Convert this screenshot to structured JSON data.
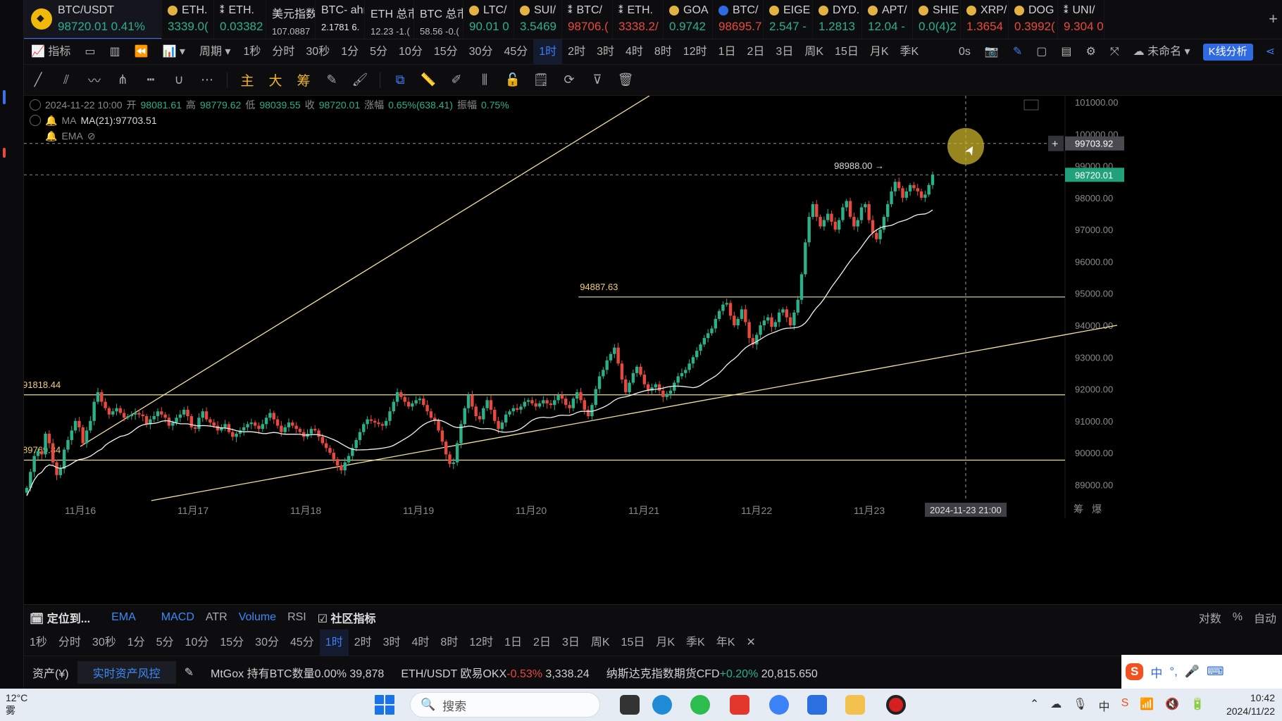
{
  "tickers": [
    {
      "name": "BTC/USDT",
      "price": "98720.01",
      "change": "0.41%",
      "dir": "up",
      "main": true
    },
    {
      "name": "ETH.",
      "price": "3339.0(",
      "dir": "up",
      "icon": "dot"
    },
    {
      "name": "ETH.",
      "price": "0.03382",
      "dir": "up",
      "icon": "x"
    },
    {
      "name": "美元指数",
      "price": "107.0887",
      "dir": "nt",
      "icon": "none"
    },
    {
      "name": "BTC- ahr",
      "price": "2.1781  6.",
      "dir": "nt2",
      "icon": "none"
    },
    {
      "name": "ETH 总市",
      "price": "12.23  -1.(",
      "dir": "nt",
      "icon": "none"
    },
    {
      "name": "BTC 总市",
      "price": "58.56  -0.(",
      "dir": "nt",
      "icon": "none"
    },
    {
      "name": "LTC/",
      "price": "90.01  0",
      "dir": "up",
      "icon": "dot"
    },
    {
      "name": "SUI/",
      "price": "3.5469",
      "dir": "up",
      "icon": "dot"
    },
    {
      "name": "BTC/",
      "price": "98706.(",
      "dir": "dn",
      "icon": "x"
    },
    {
      "name": "ETH.",
      "price": "3338.2/",
      "dir": "dn",
      "icon": "x"
    },
    {
      "name": "GOA",
      "price": "0.9742",
      "dir": "up",
      "icon": "dot"
    },
    {
      "name": "BTC/",
      "price": "98695.7",
      "dir": "dn",
      "icon": "blue"
    },
    {
      "name": "EIGE",
      "price": "2.547  -",
      "dir": "up",
      "icon": "dot"
    },
    {
      "name": "DYD.",
      "price": "1.2813",
      "dir": "up",
      "icon": "dot"
    },
    {
      "name": "APT/",
      "price": "12.04  -",
      "dir": "up",
      "icon": "dot"
    },
    {
      "name": "SHIE",
      "price": "0.0(4)2",
      "dir": "up",
      "icon": "dot"
    },
    {
      "name": "XRP/",
      "price": "1.3654",
      "dir": "dn",
      "icon": "dot"
    },
    {
      "name": "DOG",
      "price": "0.3992(",
      "dir": "dn",
      "icon": "dot"
    },
    {
      "name": "UNI/",
      "price": "9.304  0",
      "dir": "dn",
      "icon": "x"
    }
  ],
  "toolbar1": {
    "indicators": "指标",
    "period": "周期",
    "intervals": [
      "1秒",
      "分时",
      "30秒",
      "1分",
      "5分",
      "10分",
      "15分",
      "30分",
      "45分",
      "1时",
      "2时",
      "3时",
      "4时",
      "8时",
      "12时",
      "1日",
      "2日",
      "3日",
      "周K",
      "15日",
      "月K",
      "季K"
    ],
    "selected_interval": "1时",
    "countdown": "0s",
    "layout_name": "未命名",
    "kline_analysis": "K线分析"
  },
  "toolbar2": {
    "text_tools": [
      "主",
      "大",
      "筹"
    ]
  },
  "legend": {
    "date": "2024-11-22 10:00",
    "open_label": "开",
    "open": "98081.61",
    "high_label": "高",
    "high": "98779.62",
    "low_label": "低",
    "low": "98039.55",
    "close_label": "收",
    "close": "98720.01",
    "change_label": "涨幅",
    "change": "0.65%(638.41)",
    "amp_label": "振幅",
    "amp": "0.75%",
    "ma_name": "MA",
    "ma_value": "MA(21):97703.51",
    "ema_name": "EMA"
  },
  "chart_data": {
    "type": "candlestick",
    "symbol": "BTC/USDT",
    "interval": "1时",
    "ylim": [
      88500,
      101200
    ],
    "y_ticks": [
      101000,
      100000,
      99000,
      98000,
      97000,
      96000,
      95000,
      94000,
      93000,
      92000,
      91000,
      90000,
      89000
    ],
    "y_tick_labels": [
      "101000.00",
      "100000.00",
      "99000.00",
      "98000.00",
      "97000.00",
      "96000.00",
      "95000.00",
      "94000.00",
      "93000.00",
      "92000.00",
      "91000.00",
      "90000.00",
      "89000.00"
    ],
    "x_tick_labels": [
      "11月16",
      "11月17",
      "11月18",
      "11月19",
      "11月20",
      "11月21",
      "11月22",
      "11月23"
    ],
    "crosshair_time": "2024-11-23 21:00",
    "crosshair_price": "99703.92",
    "current_price": "98720.01",
    "high_marker": "98988.00 →",
    "horizontal_levels": [
      {
        "value": 94887.63,
        "label": "94887.63",
        "from_day": 4.42
      },
      {
        "value": 91818.44,
        "label": "91818.44",
        "from_day": 0
      },
      {
        "value": 89769.84,
        "label": "89769.84",
        "from_day": 0
      }
    ],
    "trendlines": [
      {
        "from": [
          0.0,
          90200
        ],
        "to": [
          5.05,
          101200
        ]
      },
      {
        "from": [
          0.63,
          88500
        ],
        "to": [
          9.2,
          94000
        ]
      }
    ],
    "closes": [
      88900,
      89400,
      89900,
      90050,
      89950,
      90600,
      90300,
      89700,
      89300,
      89500,
      90100,
      90400,
      90700,
      91000,
      90800,
      90300,
      90700,
      91000,
      91600,
      91900,
      91600,
      91400,
      91200,
      91300,
      91400,
      91250,
      91100,
      91150,
      91200,
      91250,
      91200,
      91150,
      90900,
      91050,
      91150,
      91300,
      91200,
      91100,
      90850,
      90950,
      91100,
      91200,
      91350,
      91150,
      90800,
      90750,
      91100,
      91300,
      91050,
      90950,
      90850,
      90700,
      90800,
      90900,
      90650,
      90500,
      90600,
      90700,
      90800,
      90900,
      90950,
      90850,
      90750,
      90900,
      91100,
      91250,
      91050,
      90850,
      90650,
      90800,
      90950,
      90850,
      90750,
      90650,
      90500,
      90600,
      90750,
      90700,
      90500,
      90300,
      90150,
      90000,
      89800,
      89600,
      89450,
      89700,
      89900,
      90150,
      90400,
      90650,
      90900,
      91050,
      91000,
      90950,
      90900,
      90850,
      91000,
      91300,
      91600,
      91900,
      91750,
      91600,
      91450,
      91550,
      91650,
      91700,
      91500,
      91300,
      91100,
      91000,
      90700,
      90350,
      89950,
      89650,
      89700,
      90300,
      90900,
      91400,
      91800,
      91450,
      91150,
      91050,
      91400,
      91650,
      91350,
      91000,
      90750,
      90950,
      91200,
      91300,
      91400,
      91350,
      91450,
      91600,
      91650,
      91550,
      91450,
      91550,
      91650,
      91550,
      91500,
      91650,
      91800,
      91700,
      91500,
      91400,
      91700,
      91900,
      91650,
      91350,
      91150,
      91500,
      92000,
      92400,
      92600,
      92900,
      93100,
      93300,
      92800,
      92300,
      91900,
      92200,
      92500,
      92700,
      92450,
      92150,
      91950,
      92050,
      92150,
      91950,
      91750,
      91850,
      91950,
      92200,
      92400,
      92500,
      92600,
      92800,
      93000,
      93200,
      93400,
      93600,
      93750,
      93900,
      94200,
      94450,
      94650,
      94700,
      94300,
      94000,
      94200,
      94500,
      94100,
      93600,
      93400,
      93700,
      94000,
      94150,
      94250,
      93950,
      94100,
      94400,
      94500,
      94250,
      94000,
      94400,
      94800,
      95600,
      96600,
      97400,
      97800,
      97400,
      97100,
      97300,
      97500,
      97250,
      97000,
      97300,
      97700,
      97900,
      97400,
      97100,
      97300,
      97700,
      97800,
      97300,
      96900,
      96700,
      97000,
      97400,
      97800,
      98200,
      98500,
      98300,
      98000,
      98200,
      98400,
      98300,
      98200,
      98000,
      98100,
      98400,
      98720
    ],
    "ma_label": "MA(21):97703.51"
  },
  "indicator_bar": {
    "locate": "定位到...",
    "main": [
      "EMA"
    ],
    "sub": [
      "MACD",
      "ATR",
      "Volume",
      "RSI"
    ],
    "community": "社区指标",
    "right": [
      "对数",
      "%",
      "自动"
    ]
  },
  "period_bar": {
    "items": [
      "1秒",
      "分时",
      "30秒",
      "1分",
      "5分",
      "10分",
      "15分",
      "30分",
      "45分",
      "1时",
      "2时",
      "3时",
      "4时",
      "8时",
      "12时",
      "1日",
      "2日",
      "3日",
      "周K",
      "15日",
      "月K",
      "季K",
      "年K"
    ],
    "selected": "1时"
  },
  "status_bar": {
    "assets": "资产(",
    "assets_suffix": ")",
    "risk_button": "实时资产风控",
    "items": [
      {
        "label": "MtGox 持有BTC数量",
        "pct": "0.00%",
        "value": "39,878",
        "dir": "nt"
      },
      {
        "label": "ETH/USDT 欧易OKX",
        "pct": "-0.53%",
        "value": "3,338.24",
        "dir": "dn"
      },
      {
        "label": "纳斯达克指数期货CFD",
        "pct": "+0.20%",
        "value": "20,815.650",
        "dir": "up"
      }
    ]
  },
  "ime": {
    "chars": [
      "中",
      "°,",
      "🎤",
      "⌨"
    ]
  },
  "taskbar": {
    "weather_temp": "12°C",
    "weather_desc": "雾",
    "search_placeholder": "搜索",
    "time": "10:42",
    "date": "2024/11/22"
  },
  "colors": {
    "up": "#2bb08a",
    "down": "#e8493e",
    "accent": "#2f6ae1",
    "level": "#f0d070"
  }
}
